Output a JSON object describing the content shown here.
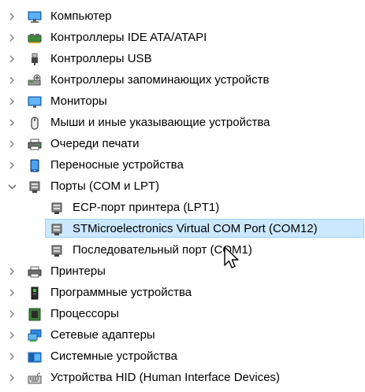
{
  "device_tree": {
    "items": [
      {
        "label": "Компьютер",
        "expanded": false,
        "icon": "computer-icon"
      },
      {
        "label": "Контроллеры IDE ATA/ATAPI",
        "expanded": false,
        "icon": "ide-controller-icon"
      },
      {
        "label": "Контроллеры USB",
        "expanded": false,
        "icon": "usb-icon"
      },
      {
        "label": "Контроллеры запоминающих устройств",
        "expanded": false,
        "icon": "storage-controller-icon"
      },
      {
        "label": "Мониторы",
        "expanded": false,
        "icon": "monitor-icon"
      },
      {
        "label": "Мыши и иные указывающие устройства",
        "expanded": false,
        "icon": "mouse-icon"
      },
      {
        "label": "Очереди печати",
        "expanded": false,
        "icon": "print-queue-icon"
      },
      {
        "label": "Переносные устройства",
        "expanded": false,
        "icon": "portable-device-icon"
      },
      {
        "label": "Порты (COM и LPT)",
        "expanded": true,
        "icon": "port-icon",
        "children": [
          {
            "label": "ECP-порт принтера (LPT1)",
            "icon": "port-icon",
            "selected": false
          },
          {
            "label": "STMicroelectronics Virtual COM Port (COM12)",
            "icon": "port-icon",
            "selected": true
          },
          {
            "label": "Последовательный порт (COM1)",
            "icon": "port-icon",
            "selected": false
          }
        ]
      },
      {
        "label": "Принтеры",
        "expanded": false,
        "icon": "printer-icon"
      },
      {
        "label": "Программные устройства",
        "expanded": false,
        "icon": "software-device-icon"
      },
      {
        "label": "Процессоры",
        "expanded": false,
        "icon": "processor-icon"
      },
      {
        "label": "Сетевые адаптеры",
        "expanded": false,
        "icon": "network-adapter-icon"
      },
      {
        "label": "Системные устройства",
        "expanded": false,
        "icon": "system-device-icon"
      },
      {
        "label": "Устройства HID (Human Interface Devices)",
        "expanded": false,
        "icon": "hid-icon"
      }
    ]
  },
  "colors": {
    "selection_fill": "#cce8ff",
    "selection_border": "#99d1ff",
    "chevron": "#7a7a7a"
  }
}
